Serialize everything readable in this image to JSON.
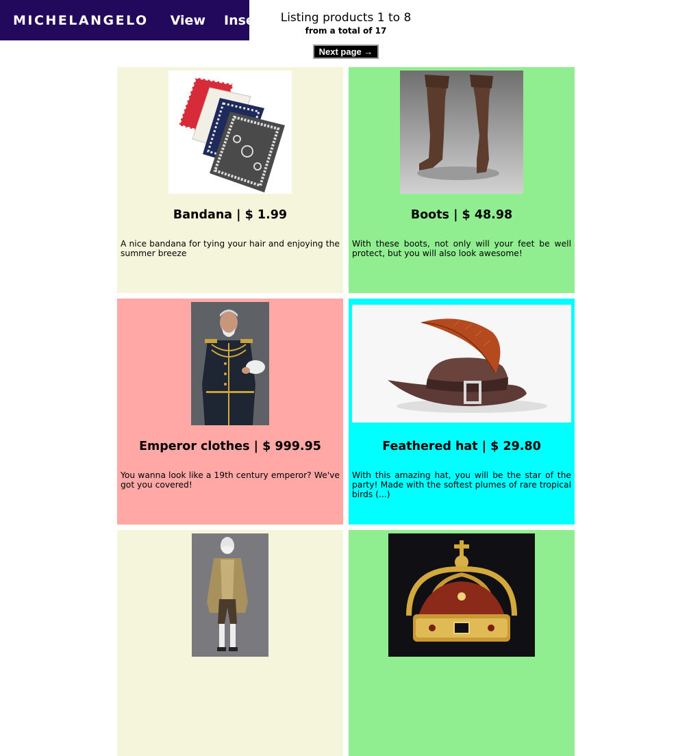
{
  "nav": {
    "brand": "MICHELANGELO",
    "view_label": "View",
    "insert_label": "Insert"
  },
  "listing": {
    "title": "Listing products 1 to 8",
    "subtitle": "from a total of 17",
    "next_label": "Next page →"
  },
  "products": [
    {
      "title": "Bandana | $ 1.99",
      "description": "A nice bandana for tying your hair and enjoying the summer breeze",
      "image_icon": "bandana-image",
      "bg_color": "#f5f5dc"
    },
    {
      "title": "Boots | $ 48.98",
      "description": "With these boots, not only will your feet be well protect, but you will also look awesome!",
      "image_icon": "boots-image",
      "bg_color": "#90ee90"
    },
    {
      "title": "Emperor clothes | $ 999.95",
      "description": "You wanna look like a 19th century emperor? We've got you covered!",
      "image_icon": "emperor-clothes-image",
      "bg_color": "#ffa8a5"
    },
    {
      "title": "Feathered hat | $ 29.80",
      "description": "With this amazing hat, you will be the star of the party! Made with the softest plumes of rare tropical birds (...)",
      "image_icon": "feathered-hat-image",
      "bg_color": "#00ffff"
    },
    {
      "title": "",
      "description": "",
      "image_icon": "period-costume-image",
      "bg_color": "#f5f5dc"
    },
    {
      "title": "",
      "description": "",
      "image_icon": "crown-image",
      "bg_color": "#90ee90"
    }
  ]
}
